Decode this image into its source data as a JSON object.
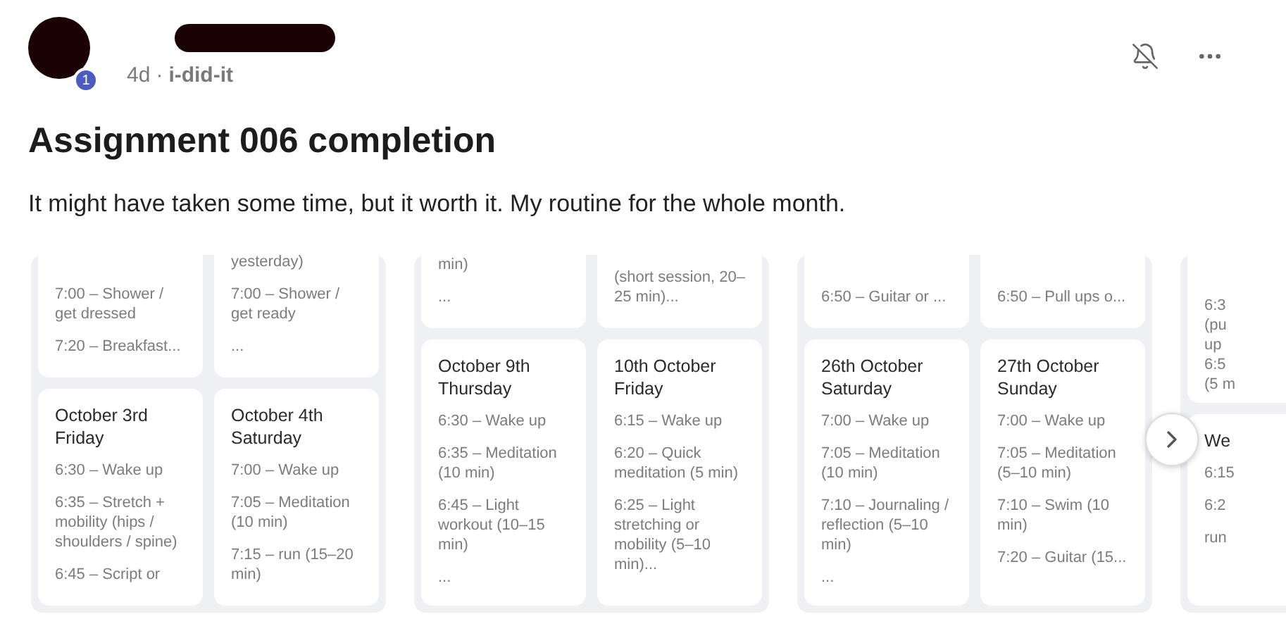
{
  "post": {
    "badge": "1",
    "age": "4d",
    "separator": "·",
    "community": "i-did-it",
    "title": "Assignment 006 completion",
    "body": "It might have taken some time, but it worth it. My routine for the whole month."
  },
  "gallery": [
    {
      "top": [
        {
          "items": [
            "7:00 – Shower / get dressed",
            "7:20 – Breakfast..."
          ]
        },
        {
          "items": [
            "yesterday)",
            "7:00 – Shower / get ready",
            "..."
          ]
        }
      ],
      "bottom": [
        {
          "date": "October 3rd",
          "day": "Friday",
          "items": [
            "6:30 – Wake up",
            "6:35 – Stretch + mobility (hips / shoulders / spine)",
            "6:45 – Script or"
          ]
        },
        {
          "date": "October 4th",
          "day": "Saturday",
          "items": [
            "7:00 – Wake up",
            "7:05 – Meditation (10 min)",
            "7:15 – run (15–20 min)"
          ]
        }
      ]
    },
    {
      "top": [
        {
          "items": [
            "min)",
            "..."
          ]
        },
        {
          "items": [
            "(short session, 20–25 min)..."
          ]
        }
      ],
      "bottom": [
        {
          "date": "October 9th",
          "day": "Thursday",
          "items": [
            "6:30 – Wake up",
            "6:35 – Meditation (10 min)",
            "6:45 – Light workout (10–15 min)",
            "..."
          ]
        },
        {
          "date": "10th October",
          "day": "Friday",
          "items": [
            "6:15 – Wake up",
            "6:20 – Quick meditation (5 min)",
            "6:25 – Light stretching or mobility (5–10 min)..."
          ]
        }
      ]
    },
    {
      "top": [
        {
          "items": [
            "6:50 – Guitar or ..."
          ]
        },
        {
          "items": [
            "6:50 – Pull ups o..."
          ]
        }
      ],
      "bottom": [
        {
          "date": "26th October",
          "day": "Saturday",
          "items": [
            "7:00 – Wake up",
            "7:05 – Meditation (10 min)",
            "7:10 – Journaling / reflection (5–10 min)",
            "..."
          ]
        },
        {
          "date": "27th October",
          "day": "Sunday",
          "items": [
            "7:00 – Wake up",
            "7:05 – Meditation (5–10 min)",
            "7:10 – Swim (10 min)",
            "7:20 – Guitar (15..."
          ]
        }
      ]
    },
    {
      "top": [
        {
          "items": [
            "6:3",
            "(pu",
            "up",
            "6:5",
            "(5 m"
          ]
        }
      ],
      "bottom": [
        {
          "day": "We",
          "items": [
            "6:15",
            "6:2",
            "run"
          ]
        }
      ]
    }
  ]
}
